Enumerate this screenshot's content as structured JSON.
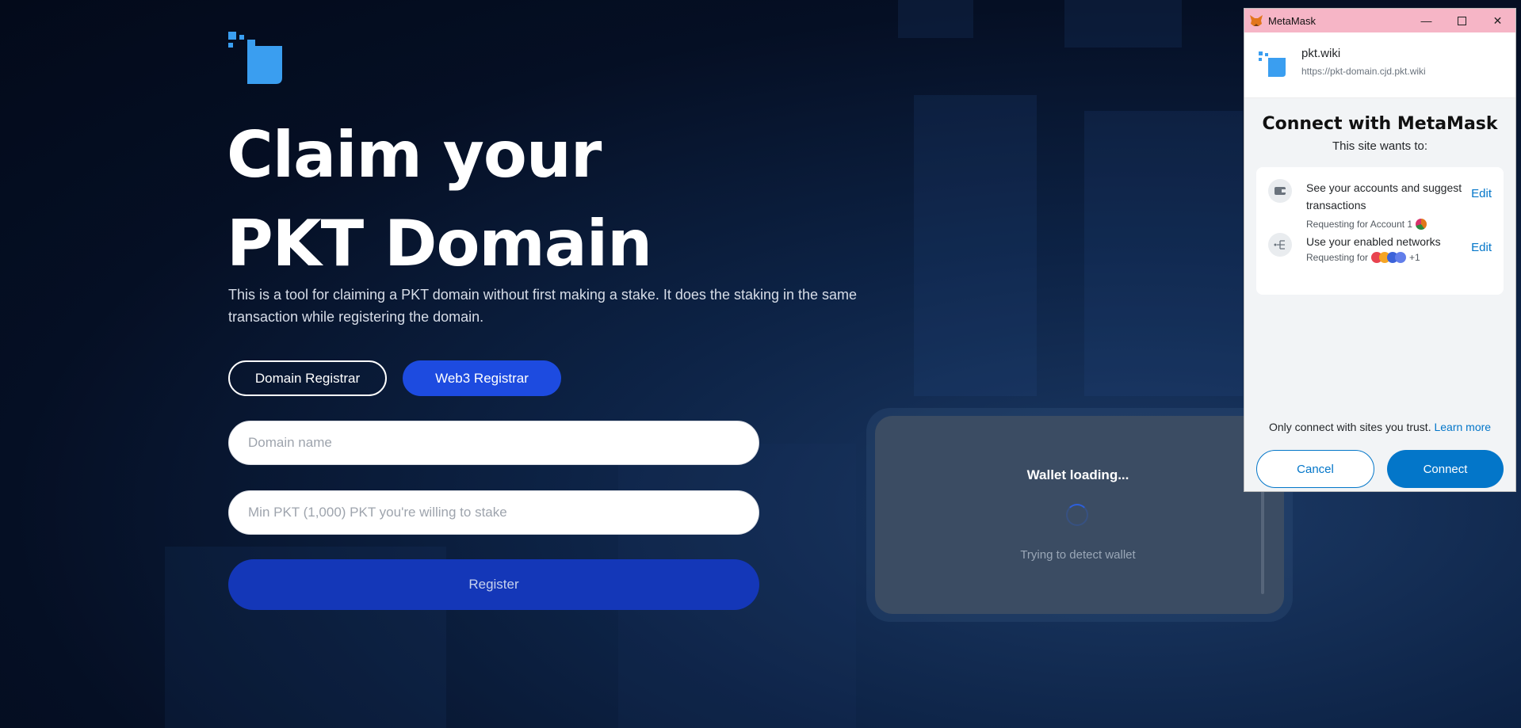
{
  "page": {
    "headline_line1": "Claim your",
    "headline_line2": "PKT Domain",
    "intro": "This is a tool for claiming a PKT domain without first making a stake. It does the staking in the same transaction while registering the domain.",
    "tabs": [
      {
        "label": "Domain Registrar"
      },
      {
        "label": "Web3 Registrar"
      }
    ],
    "domain_placeholder": "Domain name",
    "stake_placeholder": "Min PKT (1,000) PKT you're willing to stake",
    "register_label": "Register",
    "colors": {
      "accent": "#1d4be0",
      "register": "#1437b8",
      "logo": "#3a9ef0"
    }
  },
  "wallet": {
    "title": "Wallet loading...",
    "subtitle": "Trying to detect wallet"
  },
  "metamask": {
    "window_title": "MetaMask",
    "site_name": "pkt.wiki",
    "site_url": "https://pkt-domain.cjd.pkt.wiki",
    "heading": "Connect with MetaMask",
    "subheading": "This site wants to:",
    "permissions": [
      {
        "text": "See your accounts and suggest transactions",
        "requesting": "Requesting for Account 1",
        "edit": "Edit",
        "icon": "wallet-icon"
      },
      {
        "text": "Use your enabled networks",
        "requesting": "Requesting for",
        "extra": "+1",
        "edit": "Edit",
        "icon": "network-icon"
      }
    ],
    "trust_text": "Only connect with sites you trust.",
    "learn_more": "Learn more",
    "cancel_label": "Cancel",
    "connect_label": "Connect",
    "colors": {
      "primary": "#0376c9",
      "titlebar": "#f6b5c6"
    }
  }
}
